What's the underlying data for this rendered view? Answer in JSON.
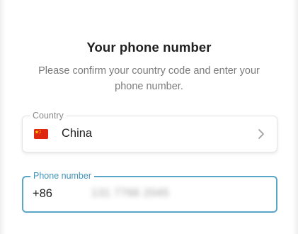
{
  "header": {
    "title": "Your phone number",
    "subtitle": "Please confirm your country code and enter your phone number."
  },
  "country_field": {
    "label": "Country",
    "value": "China",
    "flag_icon": "china-flag-icon",
    "chevron_icon": "chevron-right-icon"
  },
  "phone_field": {
    "label": "Phone number",
    "dial_code": "+86",
    "value": "131 7766 2045"
  },
  "colors": {
    "accent": "#5aa6c9",
    "label_accent": "#3f93bb",
    "flag_red": "#de2910",
    "flag_yellow": "#ffde00"
  }
}
